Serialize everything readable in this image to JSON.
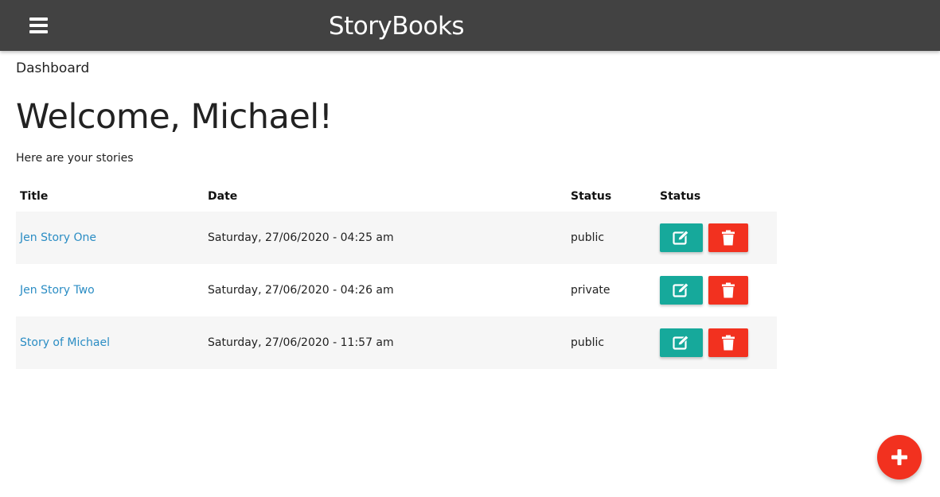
{
  "header": {
    "brand": "StoryBooks",
    "menu_icon": "hamburger-menu-icon",
    "background": "#424242"
  },
  "breadcrumb": "Dashboard",
  "welcome": "Welcome, Michael!",
  "subtitle": "Here are your stories",
  "table": {
    "headers": [
      "Title",
      "Date",
      "Status",
      "Status"
    ],
    "rows": [
      {
        "title": "Jen Story One",
        "date": "Saturday, 27/06/2020 - 04:25 am",
        "status": "public"
      },
      {
        "title": "Jen Story Two",
        "date": "Saturday, 27/06/2020 - 04:26 am",
        "status": "private"
      },
      {
        "title": "Story of Michael",
        "date": "Saturday, 27/06/2020 - 11:57 am",
        "status": "public"
      }
    ],
    "edit_icon": "edit-icon",
    "delete_icon": "trash-icon"
  },
  "fab_icon": "plus-icon",
  "colors": {
    "accent_teal": "#16a99b",
    "danger_red": "#f2311f",
    "link_blue": "#2b8dc4"
  }
}
